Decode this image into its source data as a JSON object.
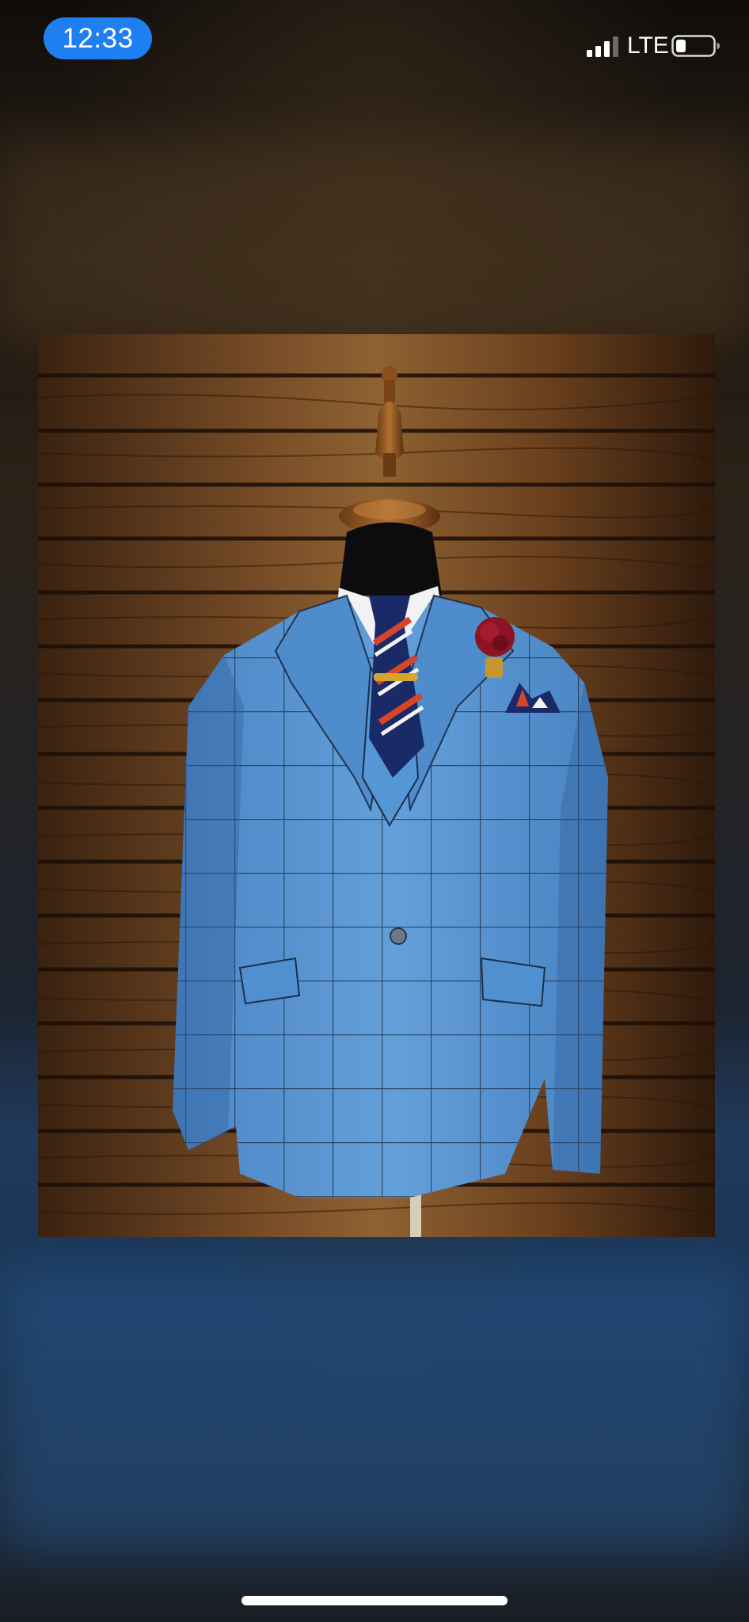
{
  "status_bar": {
    "time": "12:33",
    "network": "LTE",
    "signal_icon": "cellular-signal-icon",
    "battery_icon": "battery-low-icon",
    "time_pill_color": "#1e7ff0"
  },
  "photo": {
    "subject_icon": "blue-windowpane-check-suit-on-mannequin"
  },
  "colors": {
    "suit_blue": "#4a8fd0",
    "wood_dark": "#3a2412",
    "wood_light": "#8a5a30",
    "tie_navy": "#1a2a66",
    "tie_red": "#d8442a"
  }
}
